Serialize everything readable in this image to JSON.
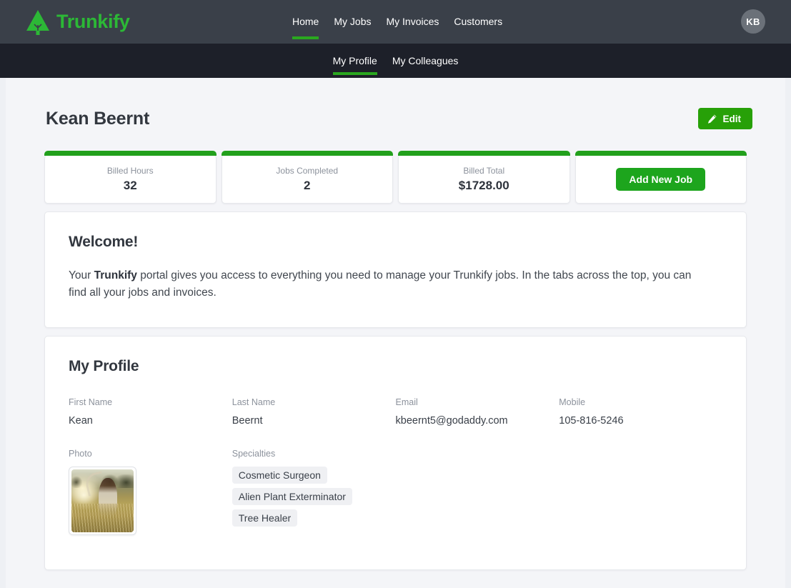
{
  "brand": {
    "name": "Trunkify",
    "logo_icon": "pine-tree-icon",
    "accent": "#2cb836"
  },
  "topnav": {
    "items": [
      {
        "label": "Home",
        "active": true
      },
      {
        "label": "My Jobs",
        "active": false
      },
      {
        "label": "My Invoices",
        "active": false
      },
      {
        "label": "Customers",
        "active": false
      }
    ],
    "avatar_initials": "KB"
  },
  "subnav": {
    "items": [
      {
        "label": "My Profile",
        "active": true
      },
      {
        "label": "My Colleagues",
        "active": false
      }
    ]
  },
  "header": {
    "title": "Kean Beernt",
    "edit_label": "Edit",
    "edit_icon": "pencil-icon",
    "edit_color": "#27a008"
  },
  "stats": [
    {
      "label": "Billed Hours",
      "value": "32"
    },
    {
      "label": "Jobs Completed",
      "value": "2"
    },
    {
      "label": "Billed Total",
      "value": "$1728.00"
    }
  ],
  "stats_action": {
    "label": "Add New Job",
    "color": "#1da51d"
  },
  "welcome": {
    "title": "Welcome!",
    "text_before": "Your ",
    "text_bold": "Trunkify",
    "text_after": " portal gives you access to everything you need to manage your Trunkify jobs. In the tabs across the top, you can find all your jobs and invoices."
  },
  "profile": {
    "title": "My Profile",
    "fields": [
      {
        "label": "First Name",
        "value": "Kean"
      },
      {
        "label": "Last Name",
        "value": "Beernt"
      },
      {
        "label": "Email",
        "value": "kbeernt5@godaddy.com"
      },
      {
        "label": "Mobile",
        "value": "105-816-5246"
      }
    ],
    "photo_label": "Photo",
    "photo_alt": "person-in-golden-field-photo",
    "specialties_label": "Specialties",
    "specialties": [
      "Cosmetic Surgeon",
      "Alien Plant Exterminator",
      "Tree Healer"
    ]
  }
}
